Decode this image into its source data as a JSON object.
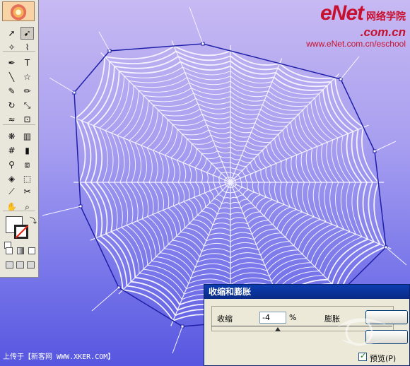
{
  "watermark": {
    "logo": "eNet",
    "school": "网络学院",
    "dotcom": ".com.cn",
    "url": "www.eNet.com.cn/eschool"
  },
  "caption": "上传于【新客网 WWW.XKER.COM】",
  "dialog": {
    "title": "收缩和膨胀",
    "left_label": "收缩",
    "value": "-4",
    "percent": "%",
    "right_label": "膨胀",
    "preview_label": "预览(P)"
  },
  "toolbox": {
    "tools": [
      {
        "name": "selection-tool",
        "glyph": "➚"
      },
      {
        "name": "direct-selection-tool",
        "glyph": "➹"
      },
      {
        "name": "magic-wand-tool",
        "glyph": "✧"
      },
      {
        "name": "lasso-tool",
        "glyph": "⌇"
      },
      {
        "name": "pen-tool",
        "glyph": "✒"
      },
      {
        "name": "type-tool",
        "glyph": "T"
      },
      {
        "name": "line-tool",
        "glyph": "╲"
      },
      {
        "name": "star-tool",
        "glyph": "☆"
      },
      {
        "name": "paintbrush-tool",
        "glyph": "✎"
      },
      {
        "name": "pencil-tool",
        "glyph": "✏"
      },
      {
        "name": "rotate-tool",
        "glyph": "↻"
      },
      {
        "name": "scale-tool",
        "glyph": "⤡"
      },
      {
        "name": "warp-tool",
        "glyph": "≈"
      },
      {
        "name": "free-transform-tool",
        "glyph": "⊡"
      },
      {
        "name": "symbol-sprayer-tool",
        "glyph": "❋"
      },
      {
        "name": "column-graph-tool",
        "glyph": "▥"
      },
      {
        "name": "mesh-tool",
        "glyph": "#"
      },
      {
        "name": "gradient-tool",
        "glyph": "▮"
      },
      {
        "name": "eyedropper-tool",
        "glyph": "⚲"
      },
      {
        "name": "blend-tool",
        "glyph": "⧈"
      },
      {
        "name": "live-paint-bucket-tool",
        "glyph": "◈"
      },
      {
        "name": "live-paint-selection-tool",
        "glyph": "⬚"
      },
      {
        "name": "slice-tool",
        "glyph": "⟋"
      },
      {
        "name": "scissors-tool",
        "glyph": "✂"
      },
      {
        "name": "hand-tool",
        "glyph": "✋"
      },
      {
        "name": "zoom-tool",
        "glyph": "⌕"
      }
    ]
  },
  "colors": {
    "web_strand": "#f4f2ff",
    "selection_path": "#1f1fa8",
    "brand": "#c8102e"
  }
}
